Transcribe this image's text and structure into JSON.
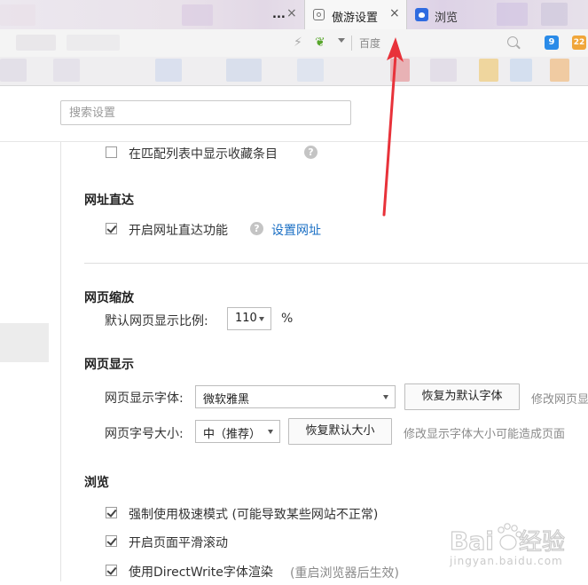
{
  "tabs": {
    "prev_title": "...",
    "active_title": "傲游设置",
    "next_title": "浏览",
    "close_glyph": "×"
  },
  "addressbar": {
    "search_engine": "百度",
    "icon1": "9",
    "icon2": "22"
  },
  "search": {
    "placeholder": "搜索设置"
  },
  "sections": {
    "top_item": {
      "label": "在匹配列表中显示收藏条目",
      "checked": false
    },
    "url_direct": {
      "heading": "网址直达",
      "checkbox_label": "开启网址直达功能",
      "checked": true,
      "link": "设置网址"
    },
    "zoom": {
      "heading": "网页缩放",
      "label": "默认网页显示比例:",
      "value": "110",
      "unit": "%"
    },
    "display": {
      "heading": "网页显示",
      "font_label": "网页显示字体:",
      "font_value": "微软雅黑",
      "font_reset": "恢复为默认字体",
      "font_note": "修改网页显",
      "size_label": "网页字号大小:",
      "size_value": "中（推荐）",
      "size_reset": "恢复默认大小",
      "size_note": "修改显示字体大小可能造成页面"
    },
    "browse": {
      "heading": "浏览",
      "items": [
        {
          "label": "强制使用极速模式 (可能导致某些网站不正常)",
          "checked": true
        },
        {
          "label": "开启页面平滑滚动",
          "checked": true
        },
        {
          "label": "使用DirectWrite字体渲染",
          "note": "(重启浏览器后生效)",
          "checked": true
        }
      ]
    }
  },
  "watermark": {
    "brand": "Baidu",
    "suffix": "经验",
    "url": "jingyan.baidu.com"
  },
  "colors": {
    "link": "#1a6fc4",
    "arrow": "#e8323a"
  }
}
